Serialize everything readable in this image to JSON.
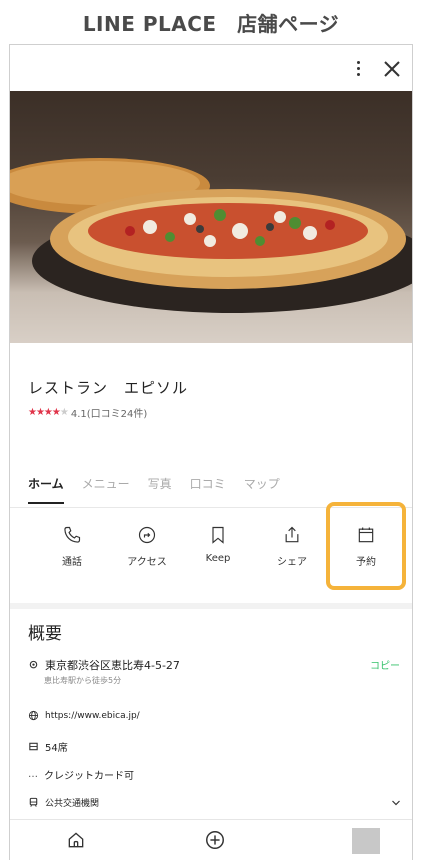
{
  "caption": "LINE PLACE　店舗ページ",
  "place": {
    "name": "レストラン　エピソル",
    "rating_value": 4.1,
    "rating_text": "4.1(口コミ24件)"
  },
  "tabs": [
    "ホーム",
    "メニュー",
    "写真",
    "口コミ",
    "マップ"
  ],
  "actions": [
    {
      "label": "通話",
      "icon": "phone-icon"
    },
    {
      "label": "アクセス",
      "icon": "navigation-icon"
    },
    {
      "label": "Keep",
      "icon": "bookmark-icon"
    },
    {
      "label": "シェア",
      "icon": "share-icon"
    },
    {
      "label": "予約",
      "icon": "calendar-icon"
    }
  ],
  "overview": {
    "title": "概要",
    "address": "東京都渋谷区恵比寿4-5-27",
    "address_sub": "恵比寿駅から徒歩5分",
    "copy_label": "コピー",
    "url": "https://www.ebica.jp/",
    "seats": "54席",
    "payment": "クレジットカード可",
    "transit": "公共交通機関"
  },
  "colors": {
    "highlight": "#f5b33a",
    "star": "#e0344a",
    "copy": "#34c16a"
  }
}
